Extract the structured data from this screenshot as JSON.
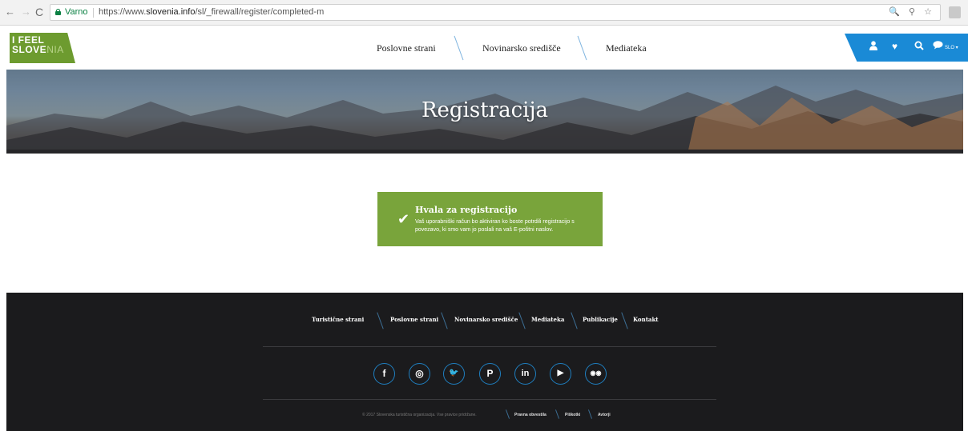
{
  "browser": {
    "back_icon": "back-arrow-icon",
    "forward_icon": "forward-arrow-icon",
    "reload_icon": "reload-icon",
    "secure_label": "Varno",
    "url_prefix": "https://www.",
    "url_host": "slovenia.info",
    "url_path": "/sl/_firewall/register/completed-m",
    "omnibox_icons": "🔍 ⚲ ☆"
  },
  "logo": {
    "line1": "I FEEL",
    "line2_bold": "SLOVE",
    "line2_light": "NIA"
  },
  "nav": {
    "items": [
      "Poslovne strani",
      "Novinarsko središče",
      "Mediateka"
    ]
  },
  "user_bar": {
    "user_icon": "user-icon",
    "heart_icon": "heart-icon",
    "search_icon": "search-icon",
    "lang_icon": "speech-bubble-icon",
    "lang_label": "SLO"
  },
  "hero": {
    "title": "Registracija"
  },
  "success": {
    "title": "Hvala za registracijo",
    "text": "Vaš uporabniški račun bo aktiviran ko boste potrdili registracijo s povezavo, ki smo vam jo poslali na vaš E-poštni naslov."
  },
  "footer": {
    "nav": [
      "Turistične strani",
      "Poslovne strani",
      "Novinarsko središče",
      "Mediateka",
      "Publikacije",
      "Kontakt"
    ],
    "social": [
      {
        "name": "facebook-icon",
        "glyph": "f"
      },
      {
        "name": "instagram-icon",
        "glyph": "◎"
      },
      {
        "name": "twitter-icon",
        "glyph": "🐦"
      },
      {
        "name": "pinterest-icon",
        "glyph": "P"
      },
      {
        "name": "linkedin-icon",
        "glyph": "in"
      },
      {
        "name": "youtube-icon",
        "glyph": "▶"
      },
      {
        "name": "tripadvisor-icon",
        "glyph": "◉◉"
      }
    ],
    "copyright": "© 2017 Slovenska turistična organizacija. Vse pravice pridržane.",
    "links": [
      "Pravna obvestila",
      "Piškotki",
      "Avtorji"
    ]
  }
}
